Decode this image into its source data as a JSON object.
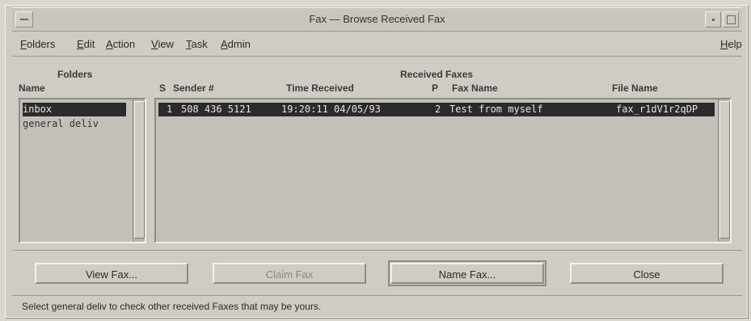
{
  "window": {
    "title": "Fax — Browse Received Fax"
  },
  "menubar": {
    "items": [
      "Folders",
      "Edit",
      "Action",
      "View",
      "Task",
      "Admin"
    ],
    "help": "Help"
  },
  "folders": {
    "heading": "Folders",
    "column": "Name",
    "items": [
      {
        "label": "inbox",
        "selected": true
      },
      {
        "label": "general deliv",
        "selected": false
      }
    ]
  },
  "received": {
    "heading": "Received Faxes",
    "columns": {
      "s": "S",
      "sender": "Sender #",
      "time": "Time Received",
      "p": "P",
      "fax_name": "Fax Name",
      "file_name": "File Name"
    },
    "rows": [
      {
        "s": "1",
        "sender": "508 436 5121",
        "time": "19:20:11 04/05/93",
        "p": "2",
        "fax_name": "Test from myself",
        "file_name": "fax_r1dV1r2qDP",
        "selected": true
      }
    ]
  },
  "buttons": {
    "view": "View Fax...",
    "claim": "Claim Fax",
    "name": "Name Fax...",
    "close": "Close"
  },
  "status": {
    "message": "Select general deliv to check other received Faxes that may be yours."
  }
}
